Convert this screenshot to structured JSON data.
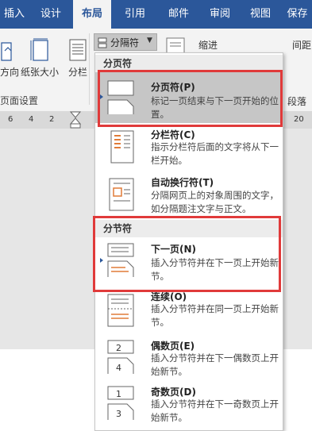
{
  "tabs": [
    "插入",
    "设计",
    "布局",
    "引用",
    "邮件",
    "审阅",
    "视图",
    "保存"
  ],
  "ribbon": {
    "orientation_label": "方向",
    "size_label": "纸张大小",
    "columns_label": "分栏",
    "breaks_label": "分隔符",
    "indent_label": "缩进",
    "spacing_label": "间距",
    "page_setup_label": "页面设置",
    "paragraph_label": "段落"
  },
  "ruler": {
    "numbers": [
      "6",
      "4",
      "2",
      "20"
    ]
  },
  "menu": {
    "page_breaks_header": "分页符",
    "section_breaks_header": "分节符",
    "items": [
      {
        "title": "分页符(P)",
        "desc": "标记一页结束与下一页开始的位置。"
      },
      {
        "title": "分栏符(C)",
        "desc": "指示分栏符后面的文字将从下一栏开始。"
      },
      {
        "title": "自动换行符(T)",
        "desc": "分隔网页上的对象周围的文字，如分隔题注文字与正文。"
      },
      {
        "title": "下一页(N)",
        "desc": "插入分节符并在下一页上开始新节。"
      },
      {
        "title": "连续(O)",
        "desc": "插入分节符并在同一页上开始新节。"
      },
      {
        "title": "偶数页(E)",
        "desc": "插入分节符并在下一偶数页上开始新节。"
      },
      {
        "title": "奇数页(D)",
        "desc": "插入分节符并在下一奇数页上开始新节。"
      }
    ]
  },
  "colors": {
    "ribbon": "#2b579a",
    "highlight": "#e03a3a"
  }
}
